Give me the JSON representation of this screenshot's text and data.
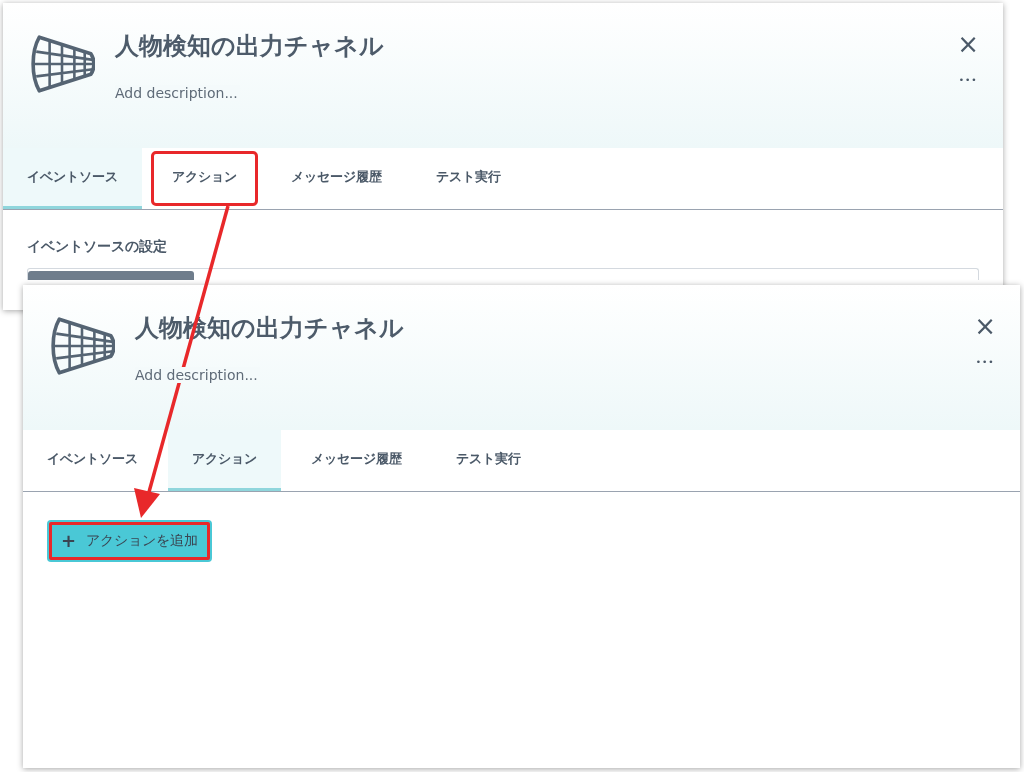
{
  "panels": [
    {
      "title": "人物検知の出力チャネル",
      "description": "Add description...",
      "close_icon": "×",
      "more_icon": "•••",
      "tabs": [
        {
          "label": "イベントソース",
          "selected": true,
          "highlighted": false
        },
        {
          "label": "アクション",
          "selected": false,
          "highlighted": true
        },
        {
          "label": "メッセージ履歴",
          "selected": false,
          "highlighted": false
        },
        {
          "label": "テスト実行",
          "selected": false,
          "highlighted": false
        }
      ],
      "section_title": "イベントソースの設定"
    },
    {
      "title": "人物検知の出力チャネル",
      "description": "Add description...",
      "close_icon": "×",
      "more_icon": "•••",
      "tabs": [
        {
          "label": "イベントソース",
          "selected": false,
          "highlighted": false
        },
        {
          "label": "アクション",
          "selected": true,
          "highlighted": false
        },
        {
          "label": "メッセージ履歴",
          "selected": false,
          "highlighted": false
        },
        {
          "label": "テスト実行",
          "selected": false,
          "highlighted": false
        }
      ],
      "add_button": {
        "icon": "+",
        "label": "アクションを追加",
        "highlighted": true
      }
    }
  ]
}
